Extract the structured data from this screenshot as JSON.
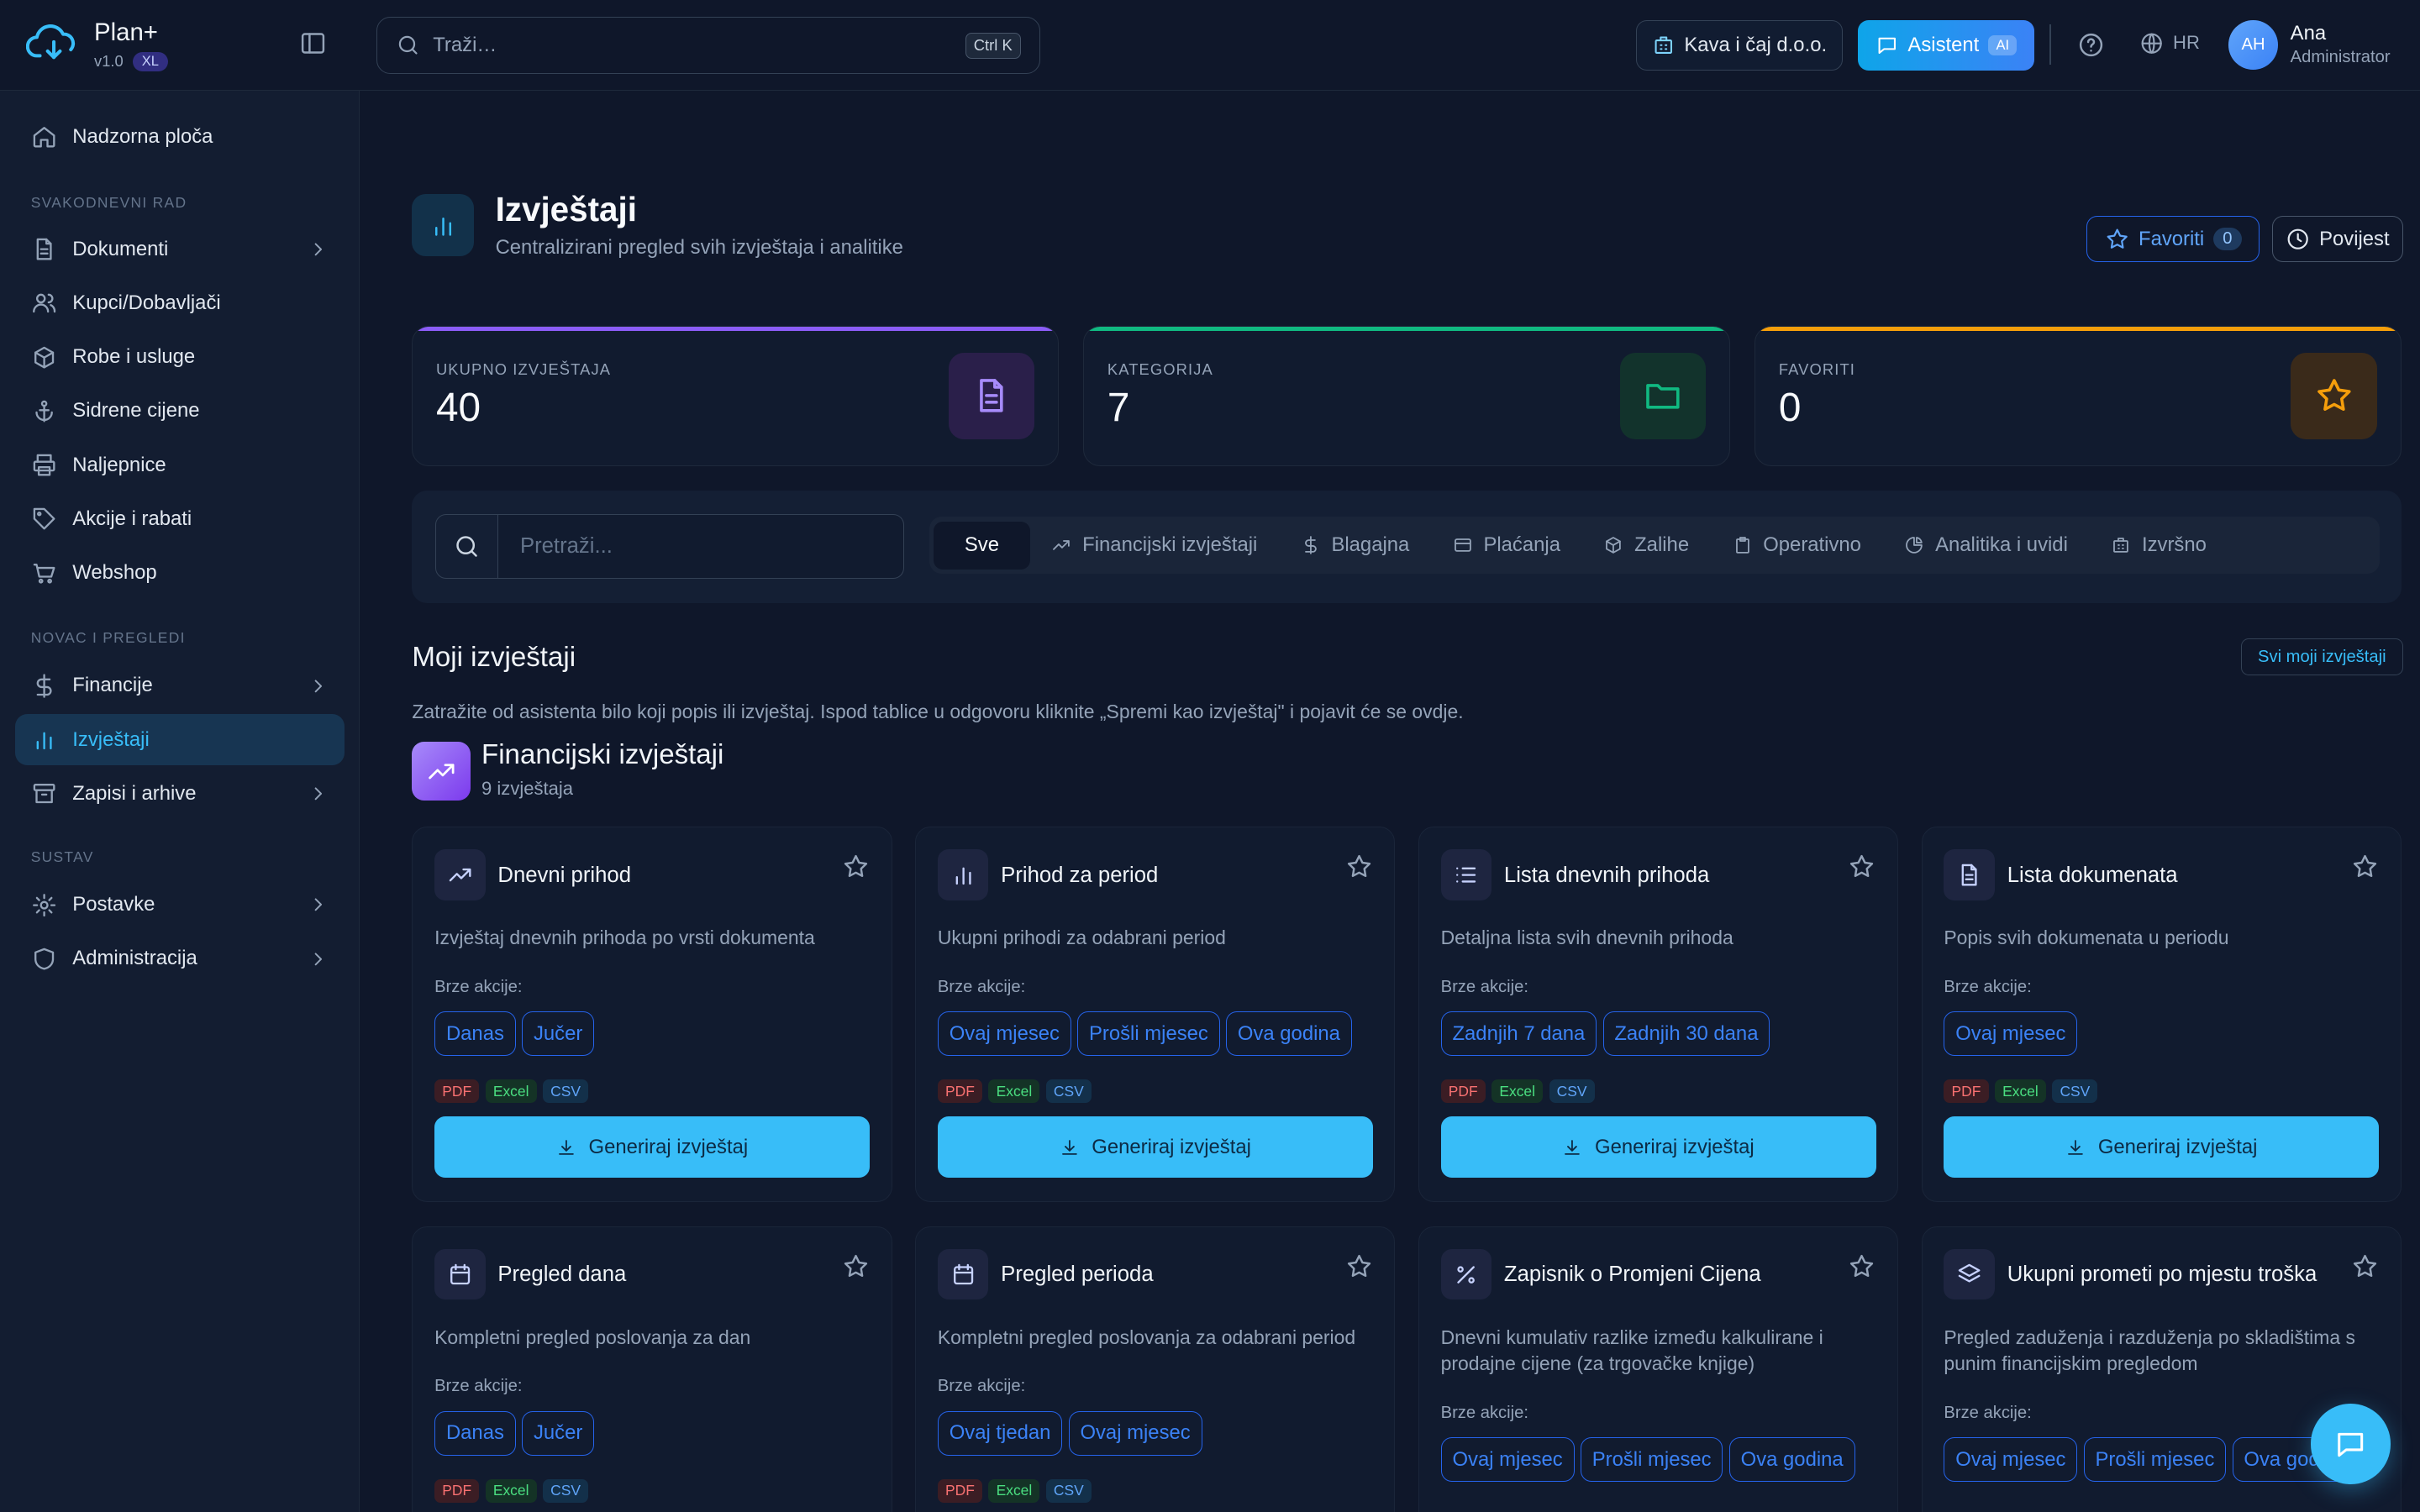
{
  "header": {
    "app_name": "Plan+",
    "version": "v1.0",
    "edition": "XL",
    "search_placeholder": "Traži…",
    "search_shortcut": "Ctrl K",
    "company": "Kava i čaj d.o.o.",
    "assistant": "Asistent",
    "assistant_badge": "AI",
    "language": "HR",
    "user_initials": "AH",
    "user_name": "Ana",
    "user_role": "Administrator"
  },
  "sidebar": {
    "top": [
      {
        "label": "Nadzorna ploča",
        "icon": "home-icon"
      }
    ],
    "sections": [
      {
        "title": "SVAKODNEVNI RAD",
        "items": [
          {
            "label": "Dokumenti",
            "icon": "document-icon",
            "chevron": true
          },
          {
            "label": "Kupci/Dobavljači",
            "icon": "users-icon"
          },
          {
            "label": "Robe i usluge",
            "icon": "box-icon"
          },
          {
            "label": "Sidrene cijene",
            "icon": "anchor-icon"
          },
          {
            "label": "Naljepnice",
            "icon": "printer-icon"
          },
          {
            "label": "Akcije i rabati",
            "icon": "tag-icon"
          },
          {
            "label": "Webshop",
            "icon": "cart-icon"
          }
        ]
      },
      {
        "title": "NOVAC I PREGLEDI",
        "items": [
          {
            "label": "Financije",
            "icon": "dollar-icon",
            "chevron": true
          },
          {
            "label": "Izvještaji",
            "icon": "bar-chart-icon",
            "active": true
          },
          {
            "label": "Zapisi i arhive",
            "icon": "archive-icon",
            "chevron": true
          }
        ]
      },
      {
        "title": "SUSTAV",
        "items": [
          {
            "label": "Postavke",
            "icon": "gear-icon",
            "chevron": true
          },
          {
            "label": "Administracija",
            "icon": "shield-icon",
            "chevron": true
          }
        ]
      }
    ]
  },
  "page": {
    "title": "Izvještaji",
    "subtitle": "Centralizirani pregled svih izvještaja i analitike",
    "favorites_label": "Favoriti",
    "favorites_count": "0",
    "history_label": "Povijest"
  },
  "stats": [
    {
      "label": "UKUPNO IZVJEŠTAJA",
      "value": "40",
      "color": "#8b5cf6",
      "icon": "document-icon"
    },
    {
      "label": "KATEGORIJA",
      "value": "7",
      "color": "#10b981",
      "icon": "folder-icon"
    },
    {
      "label": "FAVORITI",
      "value": "0",
      "color": "#f59e0b",
      "icon": "star-icon"
    }
  ],
  "filter": {
    "search_placeholder": "Pretraži...",
    "tabs": [
      {
        "label": "Sve",
        "active": true
      },
      {
        "label": "Financijski izvještaji",
        "icon": "trend-icon"
      },
      {
        "label": "Blagajna",
        "icon": "dollar-icon"
      },
      {
        "label": "Plaćanja",
        "icon": "card-icon"
      },
      {
        "label": "Zalihe",
        "icon": "box-icon"
      },
      {
        "label": "Operativno",
        "icon": "clipboard-icon"
      },
      {
        "label": "Analitika i uvidi",
        "icon": "pie-icon"
      },
      {
        "label": "Izvršno",
        "icon": "building-icon"
      }
    ]
  },
  "my_reports": {
    "title": "Moji izvještaji",
    "all_link": "Svi moji izvještaji",
    "hint": "Zatražite od asistenta bilo koji popis ili izvještaj. Ispod tablice u odgovoru kliknite „Spremi kao izvještaj\" i pojavit će se ovdje."
  },
  "category": {
    "title": "Financijski izvještaji",
    "count": "9 izvještaja"
  },
  "labels": {
    "quick_actions": "Brze akcije:",
    "generate": "Generiraj izvještaj",
    "formats": [
      "PDF",
      "Excel",
      "CSV"
    ]
  },
  "reports": [
    {
      "title": "Dnevni prihod",
      "desc": "Izvještaj dnevnih prihoda po vrsti dokumenta",
      "icon": "trend-icon",
      "actions": [
        "Danas",
        "Jučer"
      ]
    },
    {
      "title": "Prihod za period",
      "desc": "Ukupni prihodi za odabrani period",
      "icon": "bar-chart-icon",
      "actions": [
        "Ovaj mjesec",
        "Prošli mjesec",
        "Ova godina"
      ]
    },
    {
      "title": "Lista dnevnih prihoda",
      "desc": "Detaljna lista svih dnevnih prihoda",
      "icon": "list-icon",
      "actions": [
        "Zadnjih 7 dana",
        "Zadnjih 30 dana"
      ]
    },
    {
      "title": "Lista dokumenata",
      "desc": "Popis svih dokumenata u periodu",
      "icon": "document-icon",
      "actions": [
        "Ovaj mjesec"
      ]
    },
    {
      "title": "Pregled dana",
      "desc": "Kompletni pregled poslovanja za dan",
      "icon": "calendar-icon",
      "actions": [
        "Danas",
        "Jučer"
      ]
    },
    {
      "title": "Pregled perioda",
      "desc": "Kompletni pregled poslovanja za odabrani period",
      "icon": "calendar-icon",
      "actions": [
        "Ovaj tjedan",
        "Ovaj mjesec"
      ]
    },
    {
      "title": "Zapisnik o Promjeni Cijena",
      "desc": "Dnevni kumulativ razlike između kalkulirane i prodajne cijene (za trgovačke knjige)",
      "icon": "percent-icon",
      "actions": [
        "Ovaj mjesec",
        "Prošli mjesec",
        "Ova godina"
      ]
    },
    {
      "title": "Ukupni prometi po mjestu troška",
      "desc": "Pregled zaduženja i razduženja po skladištima s punim financijskim pregledom",
      "icon": "layers-icon",
      "actions": [
        "Ovaj mjesec",
        "Prošli mjesec",
        "Ova godina"
      ]
    }
  ]
}
